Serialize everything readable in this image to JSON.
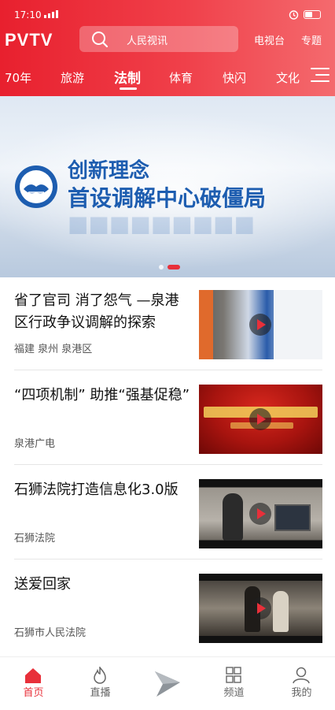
{
  "status": {
    "time": "17:10"
  },
  "header": {
    "logo": "PVTV",
    "search_placeholder": "人民视讯",
    "links": [
      "电视台",
      "专题"
    ]
  },
  "tabs": [
    "70年",
    "旅游",
    "法制",
    "体育",
    "快闪",
    "文化"
  ],
  "active_tab": "法制",
  "banner": {
    "line1": "创新理念",
    "line2": "首设调解中心破僵局",
    "page_count": 2,
    "current_page": 2
  },
  "items": [
    {
      "title": "省了官司 消了怨气 —泉港区行政争议调解的探索",
      "source": "福建 泉州 泉港区"
    },
    {
      "title": "“四项机制” 助推“强基促稳”",
      "source": "泉港广电"
    },
    {
      "title": "石狮法院打造信息化3.0版",
      "source": "石狮法院"
    },
    {
      "title": "送爱回家",
      "source": "石狮市人民法院"
    }
  ],
  "tabbar": [
    {
      "label": "首页",
      "icon": "home-icon"
    },
    {
      "label": "直播",
      "icon": "flame-icon"
    },
    {
      "label": "",
      "icon": "center-logo-icon"
    },
    {
      "label": "频道",
      "icon": "grid-icon"
    },
    {
      "label": "我的",
      "icon": "user-icon"
    }
  ],
  "colors": {
    "accent": "#e8303a",
    "header_start": "#e8202e",
    "header_end": "#f46a6e"
  }
}
